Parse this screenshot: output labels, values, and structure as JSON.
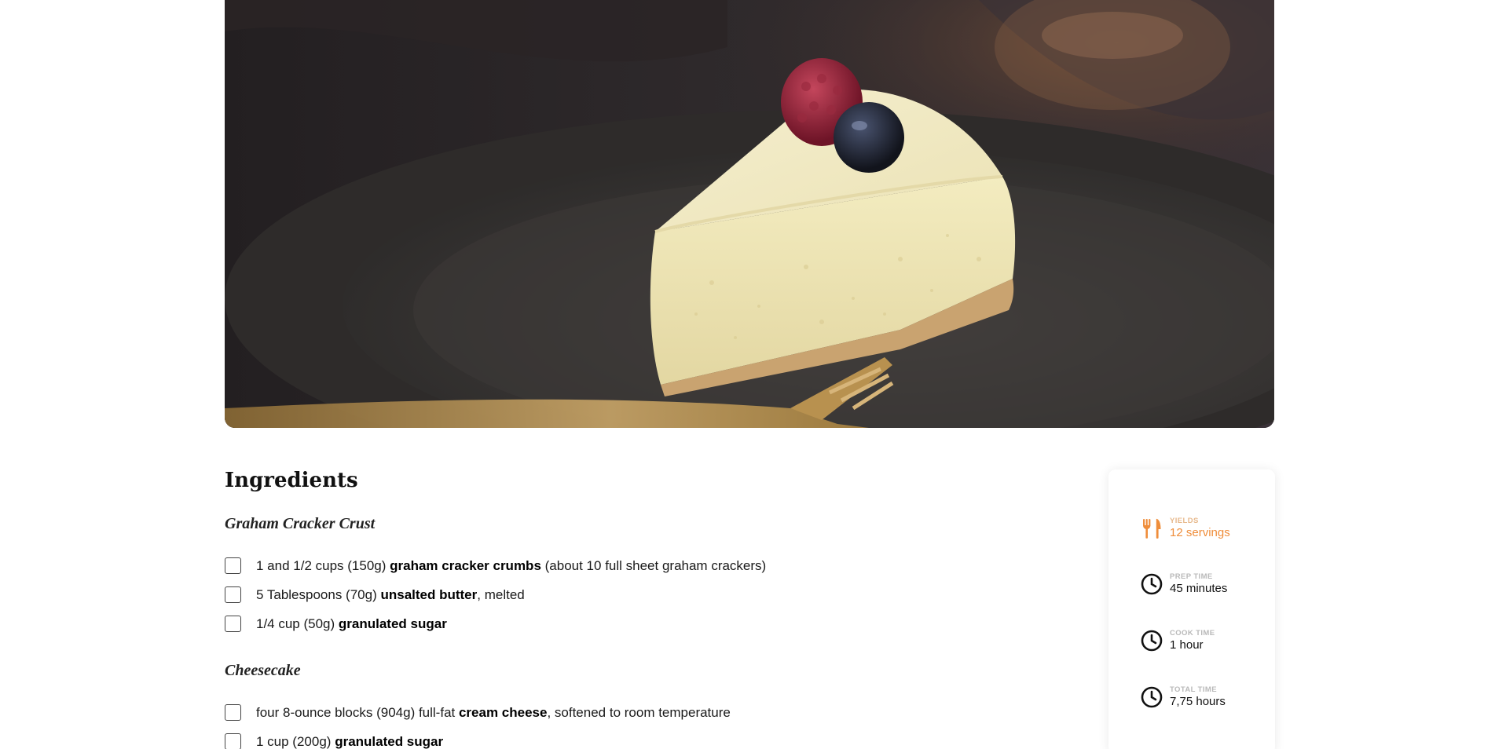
{
  "hero": {
    "image_description_icon": "cheesecake-photo"
  },
  "ingredients": {
    "title": "Ingredients",
    "groups": [
      {
        "name": "Graham Cracker Crust",
        "items": [
          {
            "before": "1 and 1/2 cups (150g) ",
            "bold": "graham cracker crumbs",
            "after": " (about 10 full sheet graham crackers)"
          },
          {
            "before": "5 Tablespoons (70g) ",
            "bold": "unsalted butter",
            "after": ", melted"
          },
          {
            "before": "1/4 cup (50g) ",
            "bold": "granulated sugar",
            "after": ""
          }
        ]
      },
      {
        "name": "Cheesecake",
        "items": [
          {
            "before": "four 8-ounce blocks (904g) full-fat ",
            "bold": "cream cheese",
            "after": ", softened to room temperature"
          },
          {
            "before": "1 cup (200g) ",
            "bold": "granulated sugar",
            "after": ""
          }
        ]
      }
    ]
  },
  "info": {
    "yields": {
      "label": "YIELDS",
      "value": "12 servings",
      "icon": "fork-knife-icon"
    },
    "prep": {
      "label": "PREP TIME",
      "value": "45 minutes",
      "icon": "clock-icon"
    },
    "cook": {
      "label": "COOK TIME",
      "value": "1 hour",
      "icon": "clock-icon"
    },
    "total": {
      "label": "TOTAL TIME",
      "value": "7,75 hours",
      "icon": "clock-icon"
    }
  },
  "colors": {
    "accent": "#ef8d3a",
    "text": "#111111",
    "muted_label": "#b9b9b9"
  }
}
